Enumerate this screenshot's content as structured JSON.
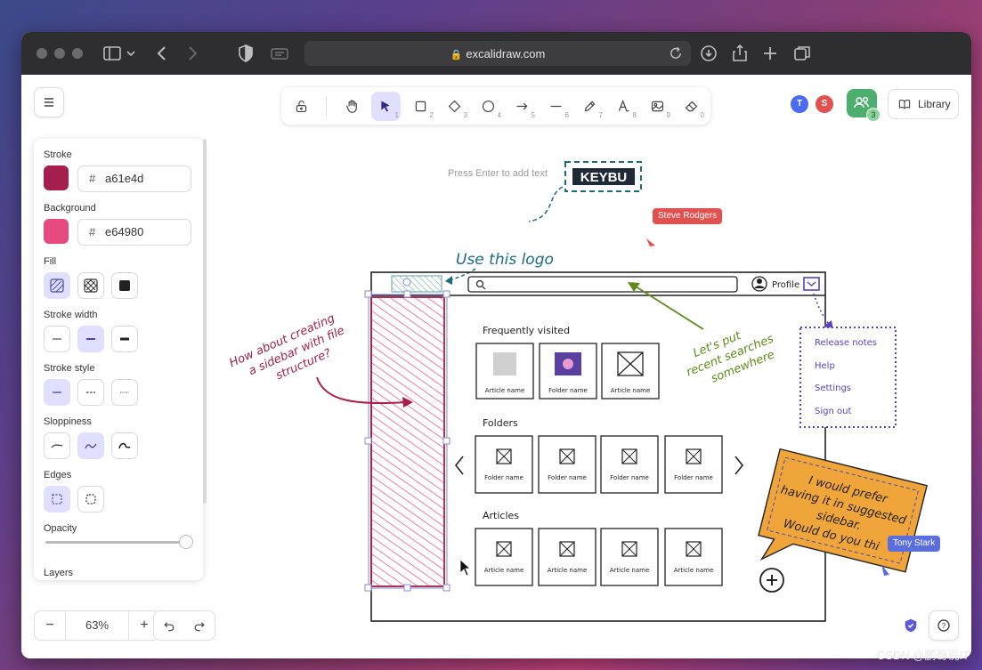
{
  "browser": {
    "url": "excalidraw.com"
  },
  "toolbar": {
    "tools": [
      {
        "name": "lock",
        "shortcut": ""
      },
      {
        "name": "hand",
        "shortcut": ""
      },
      {
        "name": "selection",
        "shortcut": "1"
      },
      {
        "name": "rectangle",
        "shortcut": "2"
      },
      {
        "name": "diamond",
        "shortcut": "3"
      },
      {
        "name": "ellipse",
        "shortcut": "4"
      },
      {
        "name": "arrow",
        "shortcut": "5"
      },
      {
        "name": "line",
        "shortcut": "6"
      },
      {
        "name": "draw",
        "shortcut": "7"
      },
      {
        "name": "text",
        "shortcut": "8"
      },
      {
        "name": "image",
        "shortcut": "9"
      },
      {
        "name": "eraser",
        "shortcut": "0"
      }
    ],
    "hint": "Press Enter to add text"
  },
  "collab": {
    "avatars": [
      {
        "initial": "T",
        "color": "#4a6cf0"
      },
      {
        "initial": "S",
        "color": "#e0514f"
      }
    ],
    "count": "3",
    "library_label": "Library"
  },
  "props": {
    "stroke_label": "Stroke",
    "stroke_hash": "#",
    "stroke_hex": "a61e4d",
    "stroke_color": "#a61e4d",
    "background_label": "Background",
    "background_hash": "#",
    "background_hex": "e64980",
    "background_color": "#e64980",
    "fill_label": "Fill",
    "stroke_width_label": "Stroke width",
    "stroke_style_label": "Stroke style",
    "sloppiness_label": "Sloppiness",
    "edges_label": "Edges",
    "opacity_label": "Opacity",
    "opacity_value": 1.0,
    "layers_label": "Layers"
  },
  "zoom": {
    "minus": "−",
    "level": "63%",
    "plus": "+"
  },
  "drawing": {
    "logo_text": "KEYBU",
    "logo_note": "Use this logo",
    "profile_label": "Profile",
    "sidebar_note": [
      "How about creating",
      "a sidebar with file",
      "structure?"
    ],
    "search_note": [
      "Let's put",
      "recent searches",
      "somewhere"
    ],
    "section_frequent": "Frequently visited",
    "frequent_items": [
      "Article name",
      "Folder name",
      "Article name"
    ],
    "section_folders": "Folders",
    "folder_items": [
      "Folder name",
      "Folder name",
      "Folder name",
      "Folder name"
    ],
    "section_articles": "Articles",
    "article_items": [
      "Article name",
      "Article name",
      "Article name",
      "Article name"
    ],
    "menu_items": [
      "Release notes",
      "Help",
      "Settings",
      "Sign out"
    ],
    "sticky_note": [
      "I would prefer",
      "having it in suggested",
      "sidebar.",
      "Would do you thi"
    ],
    "cursor_labels": [
      {
        "name": "Steve Rodgers",
        "color": "#e0514f"
      },
      {
        "name": "Tony Stark",
        "color": "#5b6ee0"
      }
    ]
  },
  "watermark": "CSDN @鹏哥说IT"
}
